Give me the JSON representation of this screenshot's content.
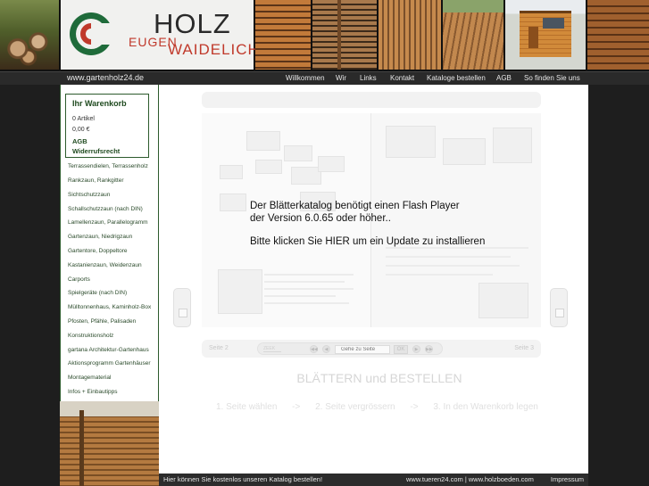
{
  "header": {
    "logo": {
      "line1": "HOLZ",
      "line2": "EUGEN",
      "line3": "WAIDELICH"
    }
  },
  "navbar": {
    "site_url": "www.gartenholz24.de",
    "items": [
      "Willkommen",
      "Wir",
      "Links",
      "Kontakt",
      "Kataloge bestellen",
      "AGB",
      "So finden Sie uns"
    ]
  },
  "sidebar": {
    "cart": {
      "title": "Ihr Warenkorb",
      "items": "0 Artikel",
      "total": "0,00 €",
      "agb": "AGB",
      "widerruf": "Widerrufsrecht"
    },
    "links": [
      "Terrassendielen, Terrassenholz",
      "Rankzaun, Rankgitter",
      "Sichtschutzzaun",
      "Schallschutzzaun (nach DIN)",
      "Lamellenzaun, Parallelogramm",
      "Gartenzaun, Niedrigzaun",
      "Gartentore, Doppeltore",
      "Kastanienzaun, Weidenzaun",
      "Carports",
      "Spielgeräte (nach DIN)",
      "Mülltonnenhaus, Kaminholz-Box",
      "Pfosten, Pfähle, Palisaden",
      "Konstruktionsholz",
      "gartana Architektur-Gartenhaus",
      "Aktionsprogramm Gartenhäuser",
      "Montagematerial",
      "Infos + Einbautipps"
    ]
  },
  "catalog": {
    "flash_line1": "Der Blätterkatalog benötigt einen Flash Player",
    "flash_line2": "der Version 6.0.65 oder höher..",
    "flash_line3": "Bitte klicken Sie HIER um ein Update zu installieren",
    "page_left": "Seite 2",
    "page_right": "Seite 3",
    "goto_placeholder": "Gehe zu Seite",
    "ok": "OK",
    "zoom_logo": "ZEEK"
  },
  "headline": "BLÄTTERN und BESTELLEN",
  "steps": [
    "1. Seite wählen",
    "->",
    "2. Seite vergrössern",
    "->",
    "3. In den Warenkorb legen"
  ],
  "footer": {
    "left": "Hier können Sie kostenlos unseren Katalog bestellen!",
    "links": "www.tueren24.com | www.holzboeden.com",
    "impressum": "Impressum"
  },
  "colors": {
    "accent_green": "#1f4a1f",
    "logo_red": "#c0392b",
    "nav_bg": "#2a2a2a"
  }
}
